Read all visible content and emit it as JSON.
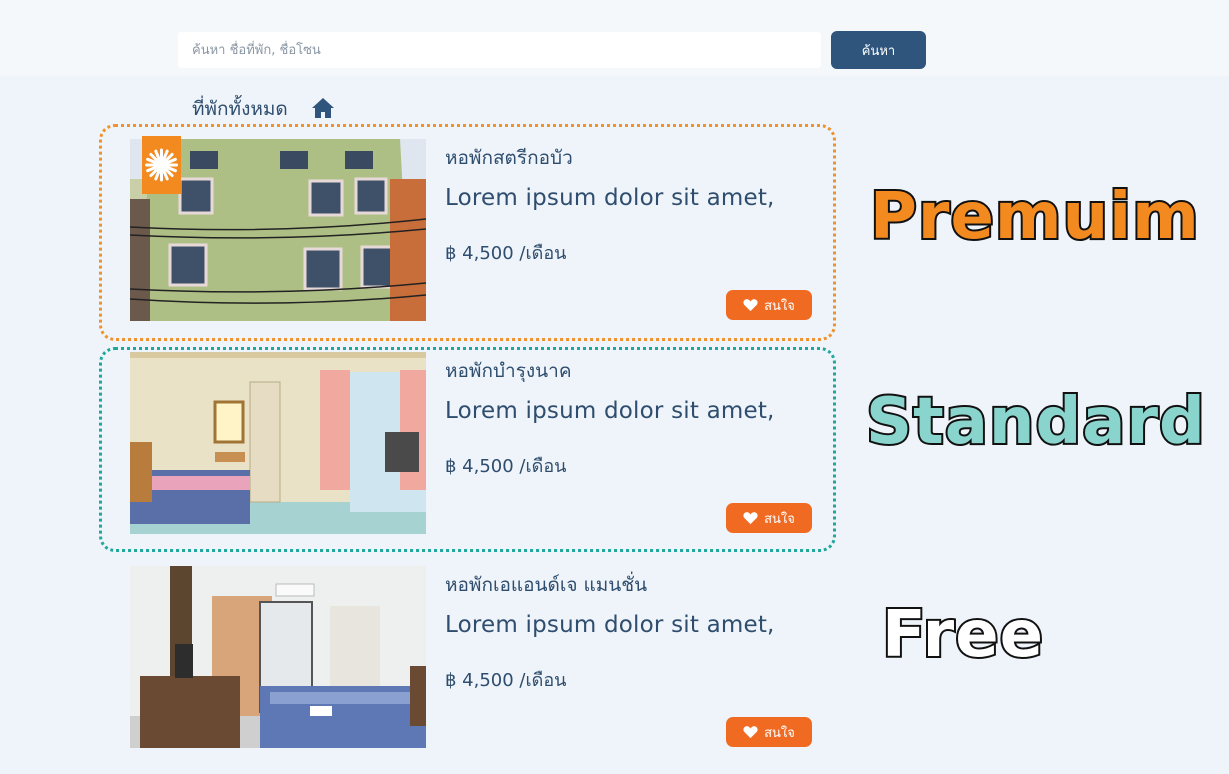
{
  "search": {
    "placeholder": "ค้นหา ชื่อที่พัก, ชื่อโซน",
    "button_label": "ค้นหา"
  },
  "page": {
    "title": "ที่พักทั้งหมด",
    "home_icon": "home-icon"
  },
  "colors": {
    "primary": "#2f557d",
    "accent_orange": "#f16a22",
    "premium_border": "#f0922b",
    "standard_border": "#1fa79b"
  },
  "listings": [
    {
      "name": "หอพักสตรีกอบัว",
      "description": "Lorem ipsum dolor sit amet,",
      "price": "฿ 4,500 /เดือน",
      "interest_label": "สนใจ",
      "tier": "premium"
    },
    {
      "name": "หอพักบำรุงนาค",
      "description": "Lorem ipsum dolor sit amet,",
      "price": "฿ 4,500 /เดือน",
      "interest_label": "สนใจ",
      "tier": "standard"
    },
    {
      "name": "หอพักเอแอนด์เจ แมนชั่น",
      "description": "Lorem ipsum dolor sit amet,",
      "price": "฿ 4,500 /เดือน",
      "interest_label": "สนใจ",
      "tier": "free"
    }
  ],
  "tier_labels": {
    "premium": "Premuim",
    "standard": "Standard",
    "free": "Free"
  }
}
